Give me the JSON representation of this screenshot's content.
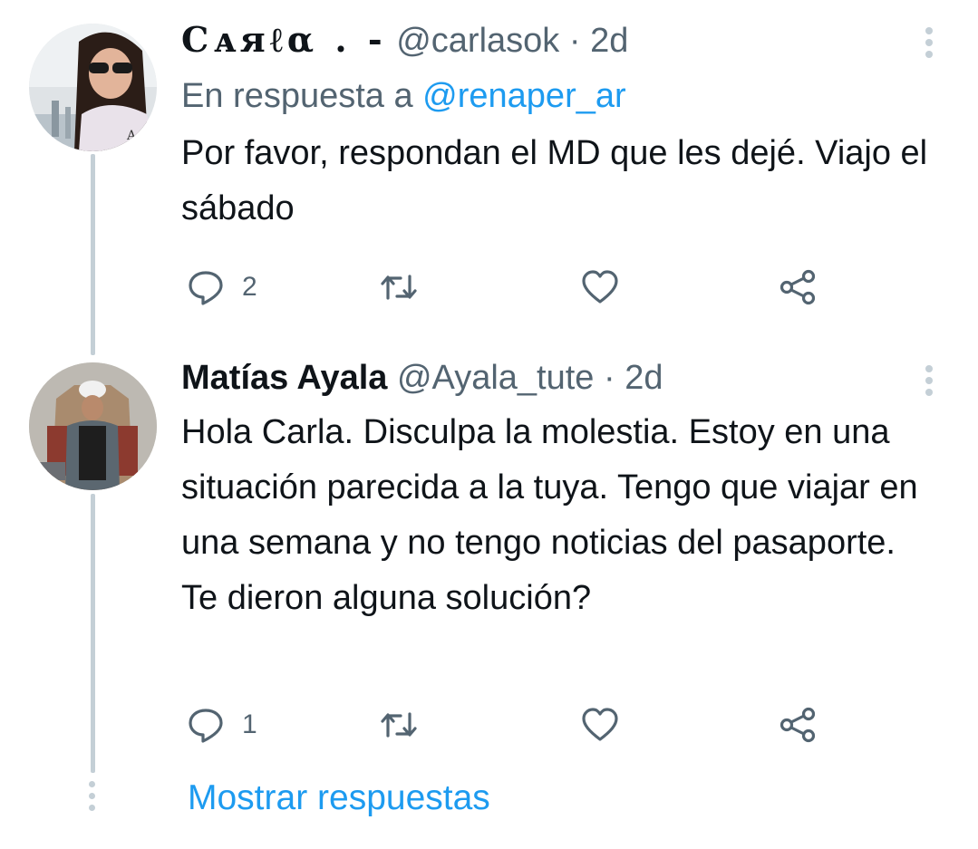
{
  "tweets": [
    {
      "display_name": "Cᴀяℓα . -",
      "handle": "@carlasok",
      "separator": "·",
      "time": "2d",
      "reply_prefix": "En respuesta a",
      "reply_mention": "@renaper_ar",
      "text": "Por favor, respondan el MD que les dejé. Viajo el sábado",
      "reply_count": "2",
      "icons": [
        "reply-icon",
        "retweet-icon",
        "like-icon",
        "share-icon",
        "more-icon"
      ]
    },
    {
      "display_name": "Matías Ayala",
      "handle": "@Ayala_tute",
      "separator": "·",
      "time": "2d",
      "text": "Hola Carla. Disculpa la molestia. Estoy en una situación parecida a la tuya. Tengo que viajar en una semana y no tengo noticias del pasaporte. Te dieron alguna solución?",
      "reply_count": "1",
      "icons": [
        "reply-icon",
        "retweet-icon",
        "like-icon",
        "share-icon",
        "more-icon"
      ]
    }
  ],
  "show_replies_label": "Mostrar respuestas",
  "colors": {
    "text_primary": "#0f1419",
    "text_secondary": "#536471",
    "accent": "#1d9bf0",
    "thread_line": "#c4cfd6"
  }
}
